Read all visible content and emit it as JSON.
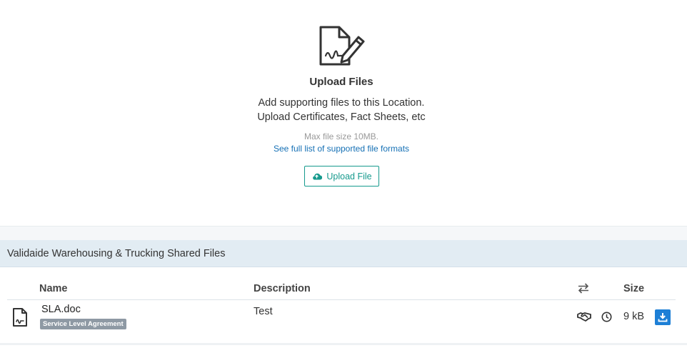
{
  "upload": {
    "icon": "signed-document-icon",
    "title": "Upload Files",
    "desc_line1": "Add supporting files to this Location.",
    "desc_line2": "Upload Certificates, Fact Sheets, etc",
    "max_size": "Max file size 10MB.",
    "formats_link": "See full list of supported file formats",
    "button_label": "Upload File",
    "button_icon": "cloud-upload-icon",
    "accent_color": "#169a8d",
    "link_color": "#1570b5"
  },
  "shared_files": {
    "title": "Validaide Warehousing & Trucking Shared Files",
    "columns": {
      "name": "Name",
      "description": "Description",
      "share_icon": "transfer-arrows-icon",
      "size": "Size"
    },
    "rows": [
      {
        "icon": "signed-document-icon",
        "name": "SLA.doc",
        "tag": "Service Level Agreement",
        "description": "Test",
        "shared_icon": "handshake-icon",
        "history_icon": "clock-icon",
        "size": "9 kB",
        "download_icon": "download-icon"
      }
    ],
    "header_bg": "#e2ecf3",
    "download_color": "#1d7fd6"
  }
}
